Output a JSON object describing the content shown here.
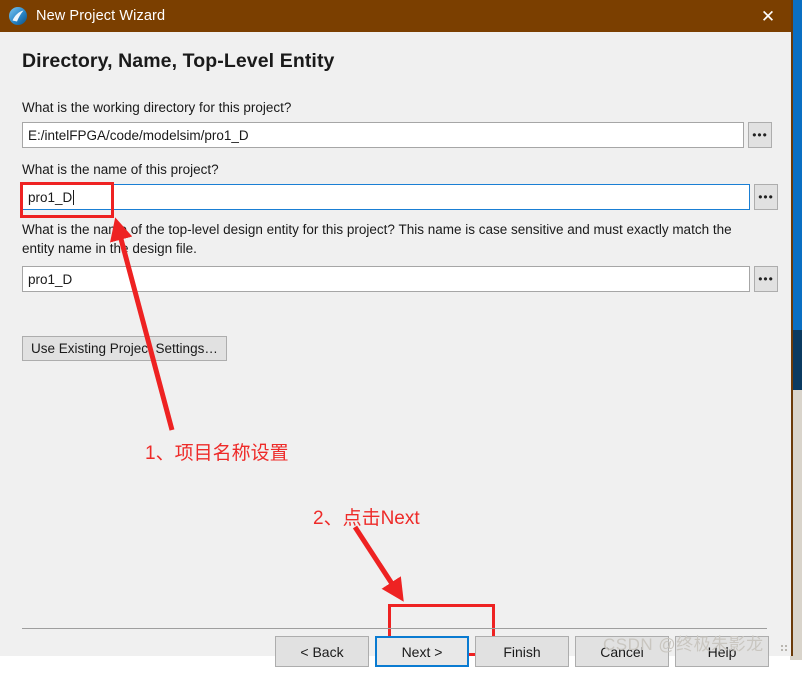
{
  "window": {
    "title": "New Project Wizard",
    "icon": "modelsim-sphere-icon",
    "close_label": "✕",
    "accent_color": "#7b3f00",
    "border_color": "#6b3a08"
  },
  "page": {
    "heading": "Directory, Name, Top-Level Entity"
  },
  "fields": {
    "working_directory": {
      "question": "What is the working directory for this project?",
      "value": "E:/intelFPGA/code/modelsim/pro1_D",
      "browse_label": "•••",
      "focused": false
    },
    "project_name": {
      "question": "What is the name of this project?",
      "value": "pro1_D",
      "browse_label": "•••",
      "focused": true
    },
    "top_level_entity": {
      "question": "What is the name of the top-level design entity for this project? This name is case sensitive and must exactly match the entity name in the design file.",
      "value": "pro1_D",
      "browse_label": "•••",
      "focused": false
    }
  },
  "buttons": {
    "use_existing_settings": "Use Existing Project Settings…",
    "back": "< Back",
    "next": "Next >",
    "finish": "Finish",
    "cancel": "Cancel",
    "help": "Help"
  },
  "annotations": {
    "accent_color": "#ee2222",
    "step1": "1、项目名称设置",
    "step2": "2、点击Next"
  },
  "watermark": {
    "text": "CSDN @终极朱影龙"
  }
}
